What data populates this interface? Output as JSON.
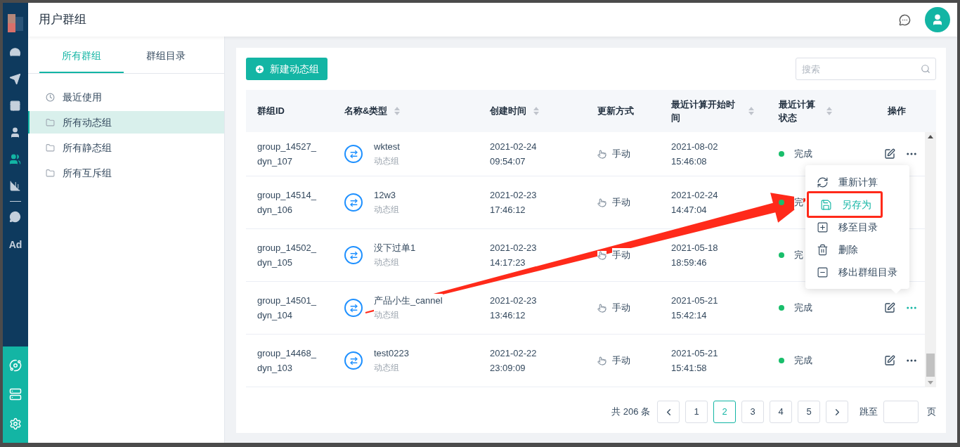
{
  "header": {
    "title": "用户群组"
  },
  "rail_items": [
    {
      "selected": false
    },
    {
      "selected": false
    },
    {
      "selected": false
    },
    {
      "selected": false
    },
    {
      "selected": true
    },
    {
      "selected": false
    },
    {
      "selected": false
    },
    {
      "label": "Ad",
      "selected": false
    }
  ],
  "tabs": [
    {
      "label": "所有群组",
      "selected": true
    },
    {
      "label": "群组目录",
      "selected": false
    }
  ],
  "nav_items": [
    {
      "label": "最近使用",
      "kind": "recent",
      "selected": false
    },
    {
      "label": "所有动态组",
      "kind": "folder",
      "selected": true
    },
    {
      "label": "所有静态组",
      "kind": "folder",
      "selected": false
    },
    {
      "label": "所有互斥组",
      "kind": "folder",
      "selected": false
    }
  ],
  "toolbar": {
    "new_button": "新建动态组",
    "search": {
      "placeholder": "搜索"
    }
  },
  "table": {
    "columns": [
      {
        "label": "群组ID",
        "sortable": false
      },
      {
        "label": "名称&类型",
        "sortable": true
      },
      {
        "label": "创建时间",
        "sortable": true
      },
      {
        "label": "更新方式",
        "sortable": false
      },
      {
        "label": "最近计算开始时间",
        "sortable": true
      },
      {
        "label": "最近计算状态",
        "sortable": true
      },
      {
        "label": "操作",
        "sortable": false
      }
    ],
    "rows": [
      {
        "id": "group_14527_dyn_107",
        "name": "wktest",
        "type": "动态组",
        "created": "2021-02-24 09:54:07",
        "update": "手动",
        "last_calc": "2021-08-02 15:46:08",
        "status": "完成",
        "menu_open": false
      },
      {
        "id": "group_14514_dyn_106",
        "name": "12w3",
        "type": "动态组",
        "created": "2021-02-23 17:46:12",
        "update": "手动",
        "last_calc": "2021-02-24 14:47:04",
        "status": "完",
        "menu_open": false
      },
      {
        "id": "group_14502_dyn_105",
        "name": "没下过单1",
        "type": "动态组",
        "created": "2021-02-23 14:17:23",
        "update": "手动",
        "last_calc": "2021-05-18 18:59:46",
        "status": "完",
        "menu_open": false
      },
      {
        "id": "group_14501_dyn_104",
        "name": "产品小生_cannel",
        "type": "动态组",
        "created": "2021-02-23 13:46:12",
        "update": "手动",
        "last_calc": "2021-05-21 15:42:14",
        "status": "完成",
        "menu_open": true
      },
      {
        "id": "group_14468_dyn_103",
        "name": "test0223",
        "type": "动态组",
        "created": "2021-02-22 23:09:09",
        "update": "手动",
        "last_calc": "2021-05-21 15:41:58",
        "status": "完成",
        "menu_open": false
      }
    ]
  },
  "menu": [
    {
      "label": "重新计算",
      "kind": "refresh",
      "highlighted": false
    },
    {
      "label": "另存为",
      "kind": "save",
      "highlighted": true
    },
    {
      "label": "移至目录",
      "kind": "move",
      "highlighted": false
    },
    {
      "label": "删除",
      "kind": "delete",
      "highlighted": false
    },
    {
      "label": "移出群组目录",
      "kind": "remove",
      "highlighted": false
    }
  ],
  "pagination": {
    "total": "共 206 条",
    "pages": [
      {
        "label": "1",
        "selected": false
      },
      {
        "label": "2",
        "selected": true
      },
      {
        "label": "3",
        "selected": false
      },
      {
        "label": "4",
        "selected": false
      },
      {
        "label": "5",
        "selected": false
      }
    ],
    "jump_label": "跳至",
    "page_suffix": "页"
  }
}
